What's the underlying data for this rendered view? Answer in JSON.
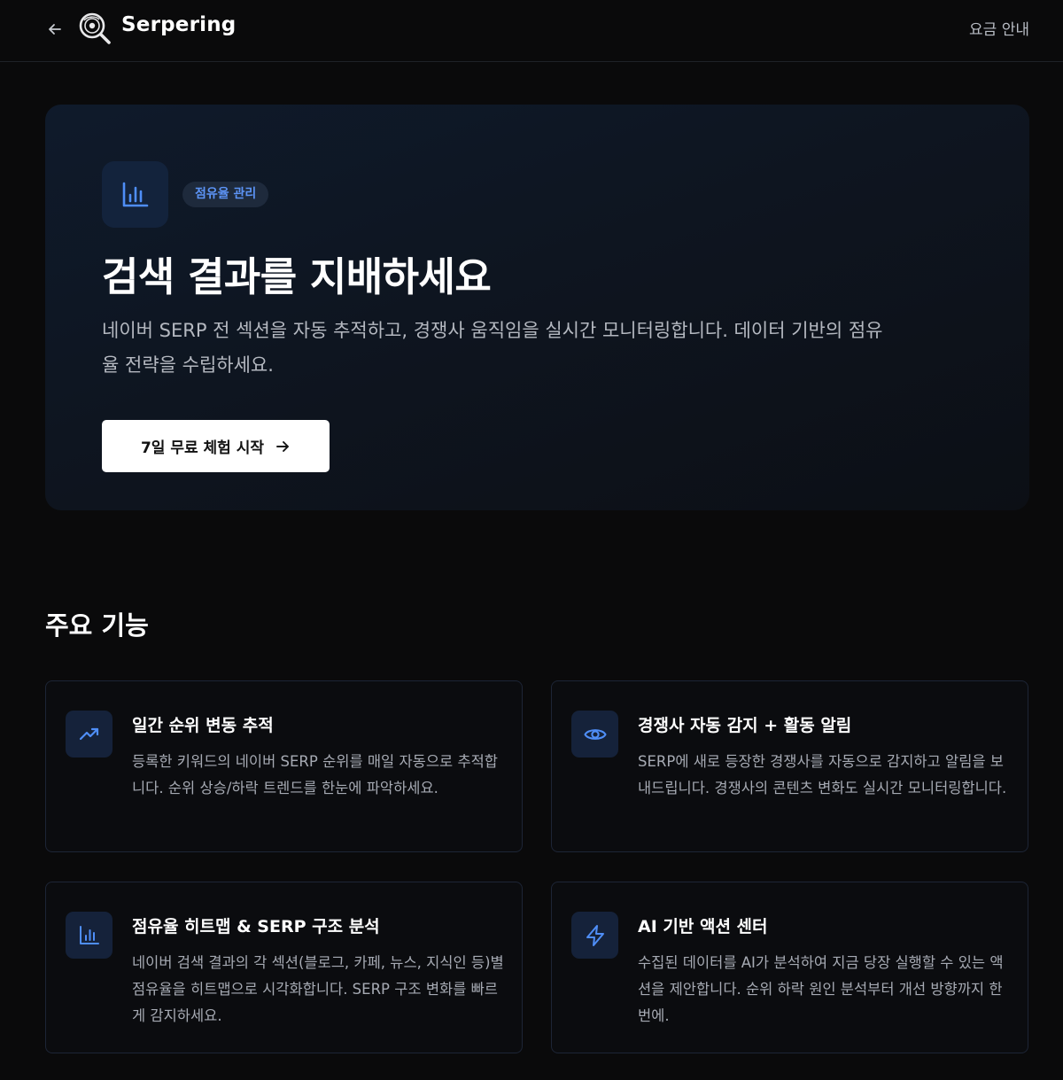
{
  "header": {
    "brand": "Serpering",
    "pricing_link": "요금 안내"
  },
  "hero": {
    "badge": "점유율 관리",
    "title": "검색 결과를 지배하세요",
    "description": "네이버 SERP 전 섹션을 자동 추적하고, 경쟁사 움직임을 실시간 모니터링합니다. 데이터 기반의 점유율 전략을 수립하세요.",
    "cta_label": "7일 무료 체험 시작"
  },
  "features": {
    "section_title": "주요 기능",
    "items": [
      {
        "icon": "trending-up-icon",
        "title": "일간 순위 변동 추적",
        "description": "등록한 키워드의 네이버 SERP 순위를 매일 자동으로 추적합니다. 순위 상승/하락 트렌드를 한눈에 파악하세요."
      },
      {
        "icon": "eye-icon",
        "title": "경쟁사 자동 감지 + 활동 알림",
        "description": "SERP에 새로 등장한 경쟁사를 자동으로 감지하고 알림을 보내드립니다. 경쟁사의 콘텐츠 변화도 실시간 모니터링합니다."
      },
      {
        "icon": "bar-chart-icon",
        "title": "점유율 히트맵 & SERP 구조 분석",
        "description": "네이버 검색 결과의 각 섹션(블로그, 카페, 뉴스, 지식인 등)별 점유율을 히트맵으로 시각화합니다. SERP 구조 변화를 빠르게 감지하세요."
      },
      {
        "icon": "lightning-icon",
        "title": "AI 기반 액션 센터",
        "description": "수집된 데이터를 AI가 분석하여 지금 당장 실행할 수 있는 액션을 제안합니다. 순위 하락 원인 분석부터 개선 방향까지 한 번에."
      }
    ]
  },
  "colors": {
    "accent": "#4f8ef7",
    "background": "#0a0a0b"
  }
}
